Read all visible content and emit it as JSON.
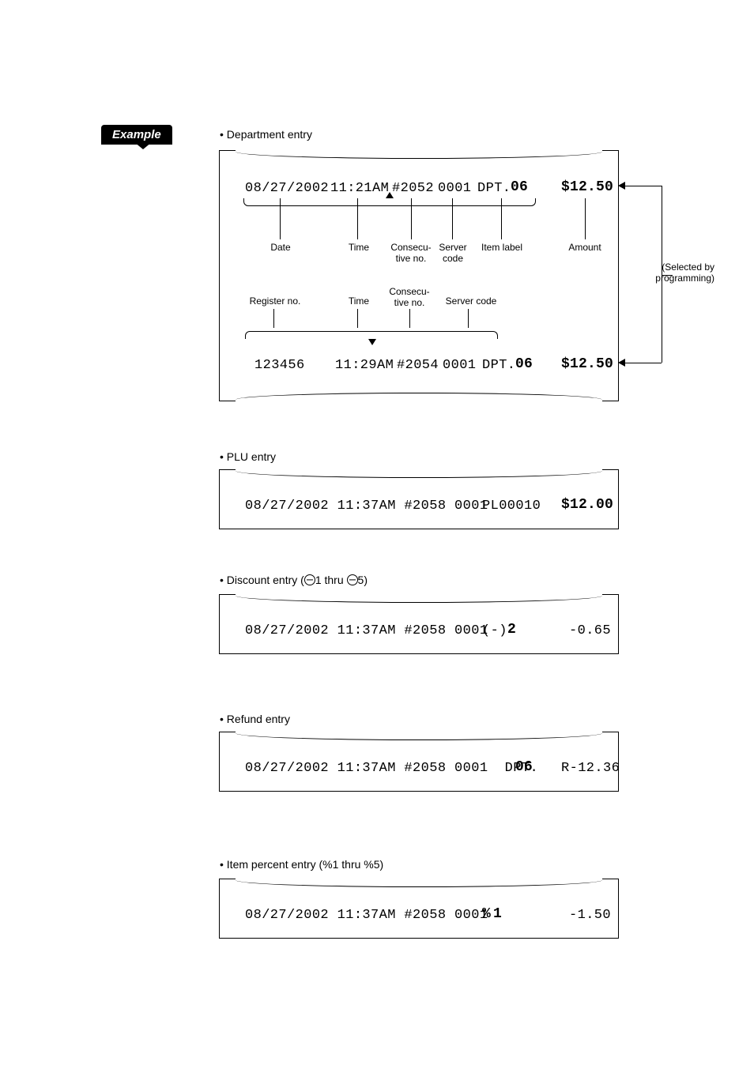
{
  "badge": "Example",
  "sections": {
    "dept": {
      "title": "• Department entry",
      "row1": {
        "date": "08/27/2002",
        "time": "11:21AM",
        "consec": "#2052",
        "server": "0001",
        "item": "DPT.",
        "item_bold": "06",
        "amount": "$12.50"
      },
      "row1_labels": {
        "date": "Date",
        "time": "Time",
        "consec": "Consecu-\ntive no.",
        "server": "Server\ncode",
        "item": "Item label",
        "amount": "Amount"
      },
      "side_note": "(Selected by\nprogramming)",
      "row2_labels": {
        "register": "Register no.",
        "time": "Time",
        "consec": "Consecu-\ntive no.",
        "server": "Server code"
      },
      "row2": {
        "register": "123456",
        "time": "11:29AM",
        "consec": "#2054",
        "server": "0001",
        "item": "DPT.",
        "item_bold": "06",
        "amount": "$12.50"
      }
    },
    "plu": {
      "title": "• PLU entry",
      "line": {
        "prefix": "08/27/2002 11:37AM #2058 0001  ",
        "item": "PL00010",
        "amount": "$12.00"
      }
    },
    "discount": {
      "title_a": "• Discount entry (",
      "title_b": "1 thru ",
      "title_c": "5)",
      "line": {
        "prefix": "08/27/2002 11:37AM #2058 0001  ",
        "item": "(-)",
        "item_bold": "2",
        "amount": "-0.65"
      }
    },
    "refund": {
      "title": "• Refund entry",
      "line": {
        "prefix": "08/27/2002 11:37AM #2058 0001  DPT.",
        "item_bold": "06",
        "amount": "R-12.36"
      }
    },
    "percent": {
      "title": "• Item percent entry (%1 thru %5)",
      "line": {
        "prefix": "08/27/2002 11:37AM #2058 0001  ",
        "item": "%",
        "item_bold": "1",
        "amount": "-1.50"
      }
    }
  }
}
